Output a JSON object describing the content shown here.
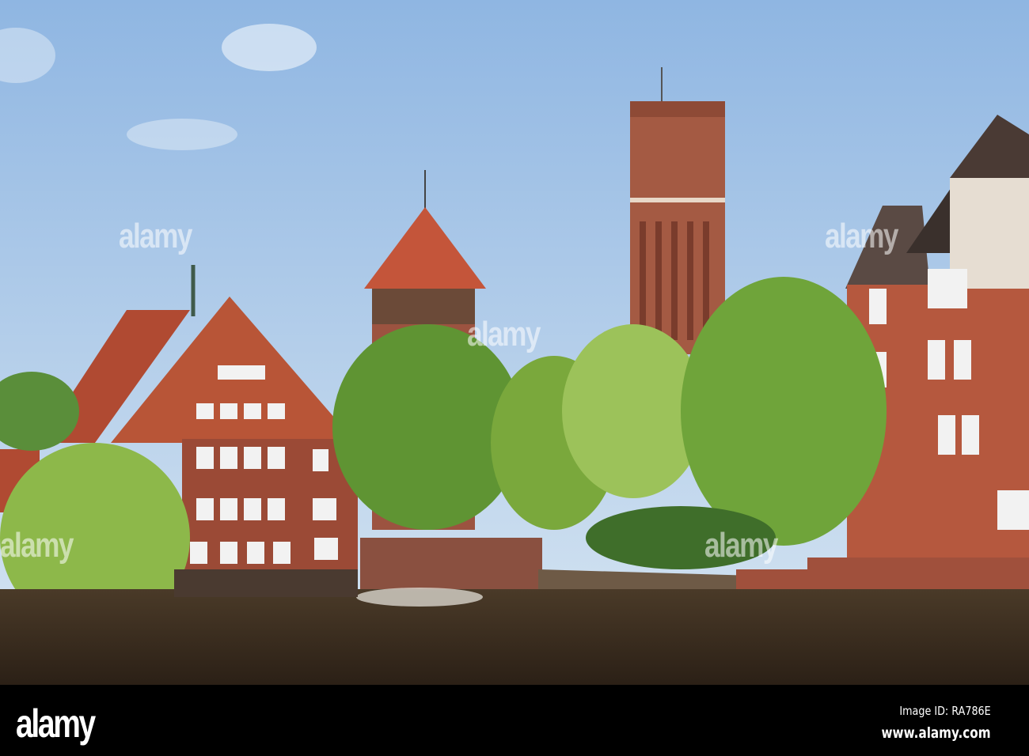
{
  "watermark": {
    "text": "alamy"
  },
  "footer": {
    "logo": "alamy",
    "image_id": "Image ID: RA786E",
    "url": "www.alamy.com"
  },
  "colors": {
    "sky_top": "#8fb6e2",
    "sky_bottom": "#cfe0f0",
    "brick": "#a45a43",
    "roof": "#c4553a",
    "water": "#3a2a1c",
    "foliage": "#6fa43a"
  }
}
